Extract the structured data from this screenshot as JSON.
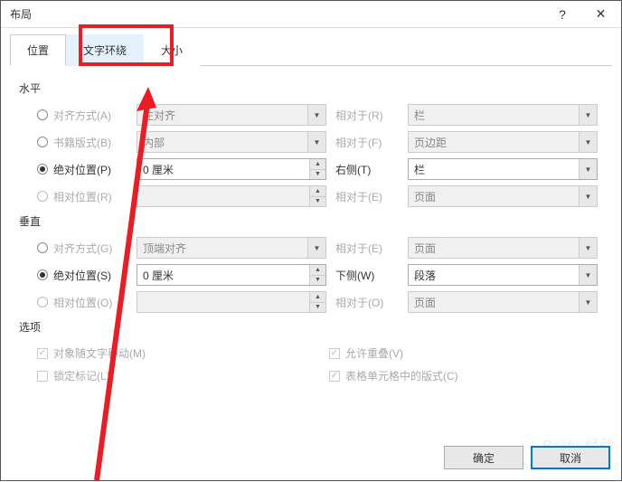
{
  "dialog": {
    "title": "布局"
  },
  "tabs": {
    "position": "位置",
    "textwrap": "文字环绕",
    "size": "大小"
  },
  "horizontal": {
    "heading": "水平",
    "align": {
      "label": "对齐方式(A)",
      "value": "左对齐",
      "rel_label": "相对于(R)",
      "rel_value": "栏"
    },
    "book": {
      "label": "书籍版式(B)",
      "value": "内部",
      "rel_label": "相对于(F)",
      "rel_value": "页边距"
    },
    "abs": {
      "label": "绝对位置(P)",
      "value": "0 厘米",
      "rel_label": "右侧(T)",
      "rel_value": "栏"
    },
    "rel": {
      "label": "相对位置(R)",
      "value": "",
      "rel_label": "相对于(E)",
      "rel_value": "页面"
    }
  },
  "vertical": {
    "heading": "垂直",
    "align": {
      "label": "对齐方式(G)",
      "value": "顶端对齐",
      "rel_label": "相对于(E)",
      "rel_value": "页面"
    },
    "abs": {
      "label": "绝对位置(S)",
      "value": "0 厘米",
      "rel_label": "下侧(W)",
      "rel_value": "段落"
    },
    "rel": {
      "label": "相对位置(O)",
      "value": "",
      "rel_label": "相对于(O)",
      "rel_value": "页面"
    }
  },
  "options": {
    "heading": "选项",
    "movewithtext": "对象随文字移动(M)",
    "lockanchor": "锁定标记(L)",
    "allowoverlap": "允许重叠(V)",
    "tablecelllayout": "表格单元格中的版式(C)"
  },
  "buttons": {
    "ok": "确定",
    "cancel": "取消"
  },
  "watermark": "Baidu 经验"
}
